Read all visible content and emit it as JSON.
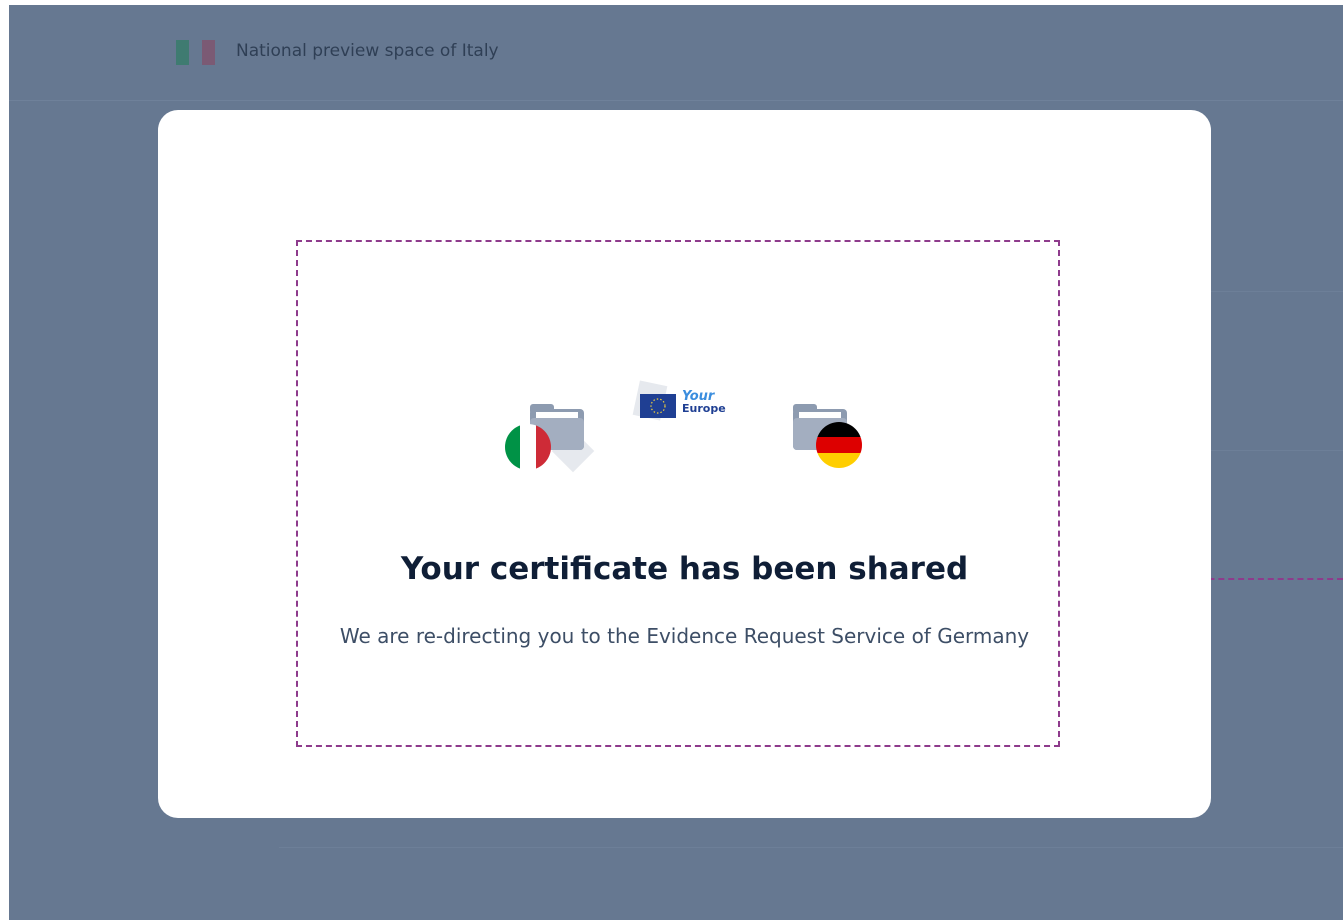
{
  "header": {
    "title": "National preview space of Italy",
    "flag_icon": "italy-flag-icon"
  },
  "dialog": {
    "title": "Your certificate has been shared",
    "message": "We are re-directing you to the Evidence Request Service of Germany",
    "logo": {
      "your": "Your",
      "europe": "Europe"
    }
  },
  "colors": {
    "backdrop": "#667891",
    "card": "#ffffff",
    "annotation": "#8e3b8c",
    "headline": "#0f1e36",
    "italy": [
      "#009246",
      "#ffffff",
      "#ce2b37"
    ],
    "germany": [
      "#000000",
      "#dd0000",
      "#ffce00"
    ]
  }
}
